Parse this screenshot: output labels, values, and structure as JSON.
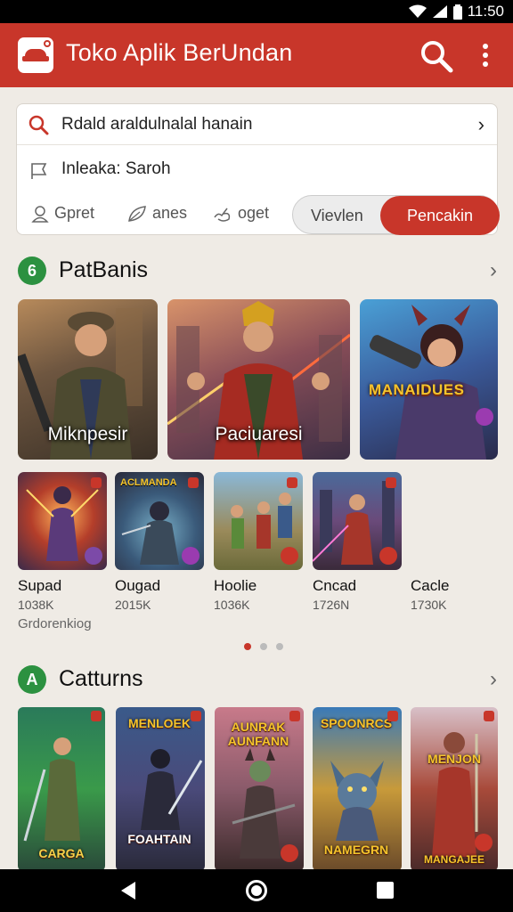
{
  "status_bar": {
    "time": "11:50"
  },
  "app_bar": {
    "title": "Toko Aplik  BerUndan"
  },
  "search": {
    "query": "Rdald araldulnalal hanain",
    "hint": "Inleaka: Saroh",
    "chips": [
      "Gpret",
      "anes",
      "oget"
    ],
    "segment_view": "Vievlen",
    "segment_active": "Pencakin"
  },
  "section1": {
    "badge": "6",
    "title": "PatBanis",
    "banners": [
      {
        "label": "Miknpesir",
        "logo": ""
      },
      {
        "label": "Paciuaresi",
        "logo": ""
      },
      {
        "label": "",
        "logo": "MANAIDUES"
      }
    ],
    "small_cards": [
      {
        "title": "",
        "name": "Supad",
        "count": "1038K"
      },
      {
        "title": "ACLMANDA",
        "name": "Ougad",
        "count": "2015K"
      },
      {
        "title": "",
        "name": "Hoolie",
        "count": "1036K"
      },
      {
        "title": "",
        "name": "Cncad",
        "count": "1726N"
      },
      {
        "title": "",
        "name": "Cacle",
        "count": "1730K"
      }
    ],
    "extra": "Grdorenkiog"
  },
  "section2": {
    "badge": "A",
    "title": "Catturns",
    "posters": [
      {
        "top_title": "",
        "bottom_title": "CARGA"
      },
      {
        "top_title": "MENLOEK",
        "bottom_title": "FOAHTAIN"
      },
      {
        "top_title": "AUNRAK AUNFANN",
        "bottom_title": ""
      },
      {
        "top_title": "SPOONRCS",
        "bottom_title": "NAMEGRN"
      },
      {
        "top_title": "MENJON",
        "bottom_title": "MANGAJEE"
      }
    ]
  },
  "colors": {
    "primary": "#c8362a",
    "badge_green": "#2c9140",
    "background": "#efebe5"
  }
}
